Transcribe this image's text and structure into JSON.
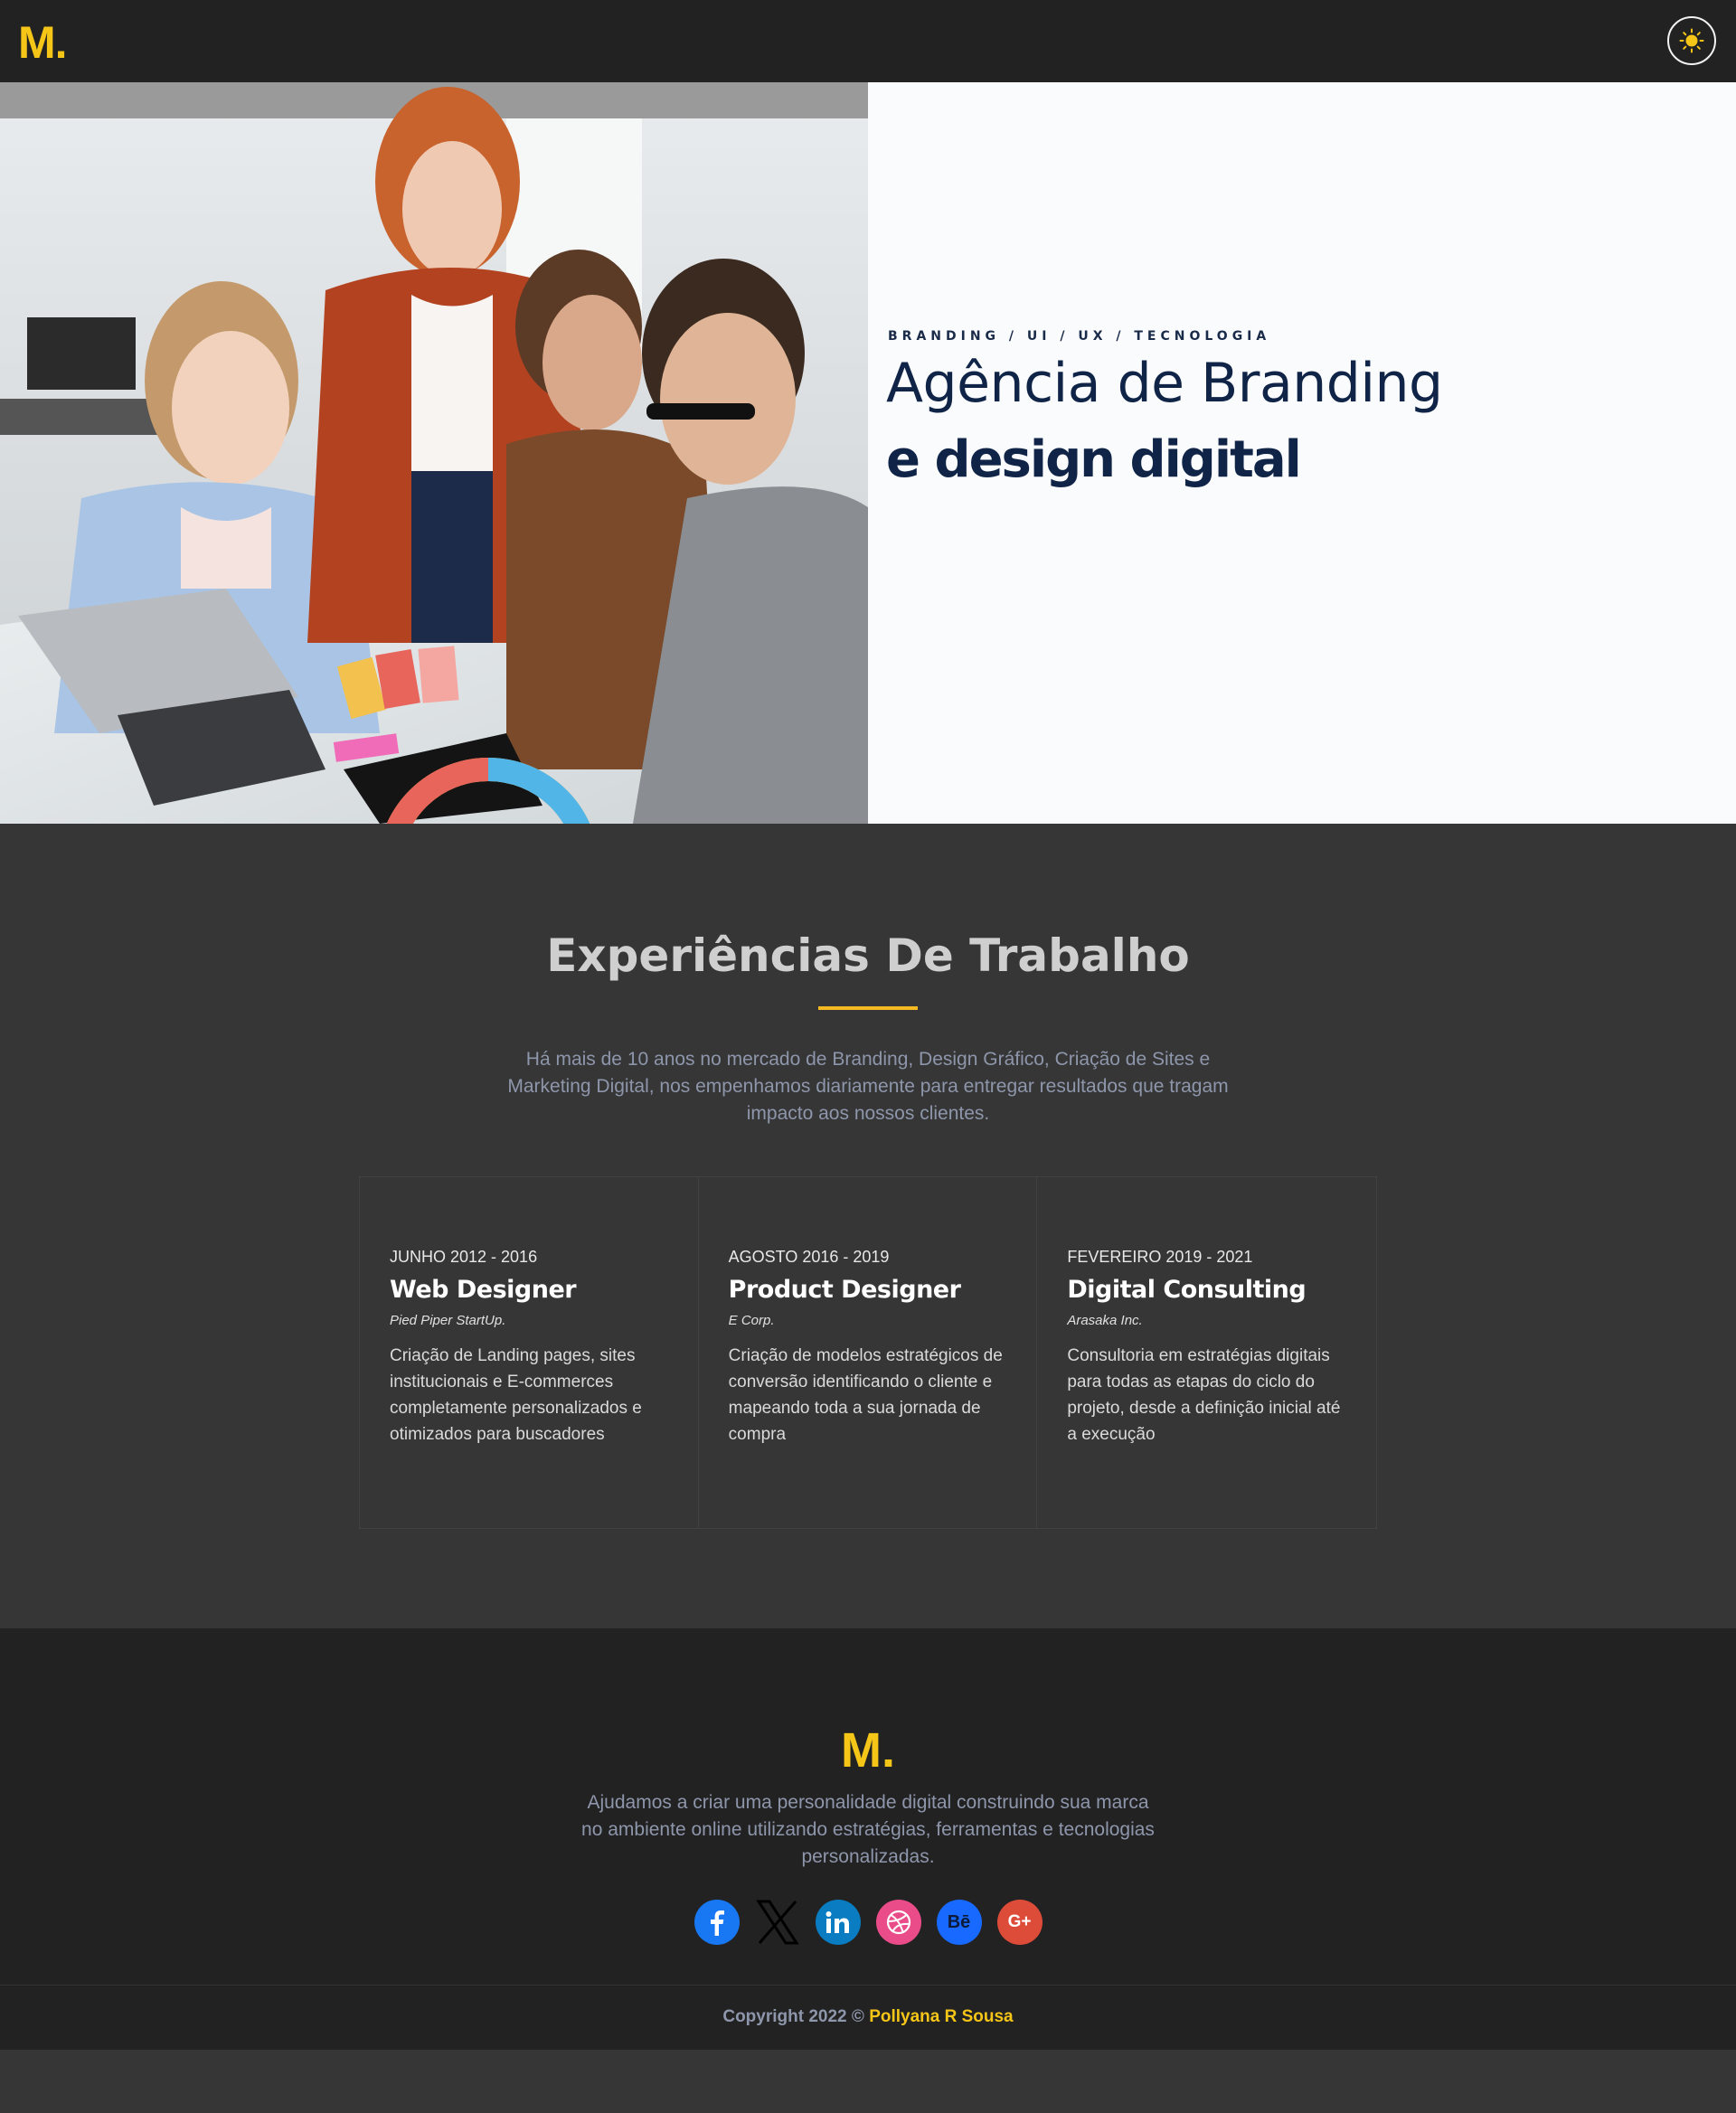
{
  "colors": {
    "brand_yellow": "#f5c518",
    "accent_rule": "#f5b922",
    "header_bg": "#222222",
    "section_bg": "#363636",
    "hero_text_color": "#0f2447"
  },
  "header": {
    "logo": "M.",
    "theme_toggle_icon": "sun-icon"
  },
  "hero": {
    "kicker": "BRANDING / UI / UX / TECNOLOGIA",
    "title_line1": "Agência de Branding",
    "title_line2": "e design digital",
    "image_description": "team-meeting-photo"
  },
  "experience": {
    "title": "Experiências De Trabalho",
    "intro": "Há mais de 10 anos no mercado de Branding, Design Gráfico, Criação de Sites e Marketing Digital, nos empenhamos diariamente para entregar resultados que tragam impacto aos nossos clientes.",
    "items": [
      {
        "period": "JUNHO 2012 - 2016",
        "role": "Web Designer",
        "company": "Pied Piper StartUp.",
        "description": "Criação de Landing pages, sites institucionais e E-commerces completamente personalizados e otimizados para buscadores"
      },
      {
        "period": "AGOSTO 2016 - 2019",
        "role": "Product Designer",
        "company": "E Corp.",
        "description": "Criação de modelos estratégicos de conversão identificando o cliente e mapeando toda a sua jornada de compra"
      },
      {
        "period": "FEVEREIRO 2019 - 2021",
        "role": "Digital Consulting",
        "company": "Arasaka Inc.",
        "description": "Consultoria em estratégias digitais para todas as etapas do ciclo do projeto, desde a definição inicial até a execução"
      }
    ]
  },
  "footer": {
    "logo": "M.",
    "text": "Ajudamos a criar uma personalidade digital construindo sua marca no ambiente online utilizando estratégias, ferramentas e tecnologias personalizadas.",
    "socials": [
      {
        "icon": "facebook-icon",
        "color": "#1877f2"
      },
      {
        "icon": "x-icon",
        "color": "#000000"
      },
      {
        "icon": "linkedin-icon",
        "color": "#0a7cc1"
      },
      {
        "icon": "dribbble-icon",
        "color": "#ea4c89"
      },
      {
        "icon": "behance-icon",
        "color": "#1769ff",
        "label": "Bē"
      },
      {
        "icon": "google-plus-icon",
        "color": "#dd4b39",
        "label": "G+"
      }
    ],
    "copyright_prefix": "Copyright 2022 ©",
    "copyright_name": "Pollyana R Sousa"
  }
}
